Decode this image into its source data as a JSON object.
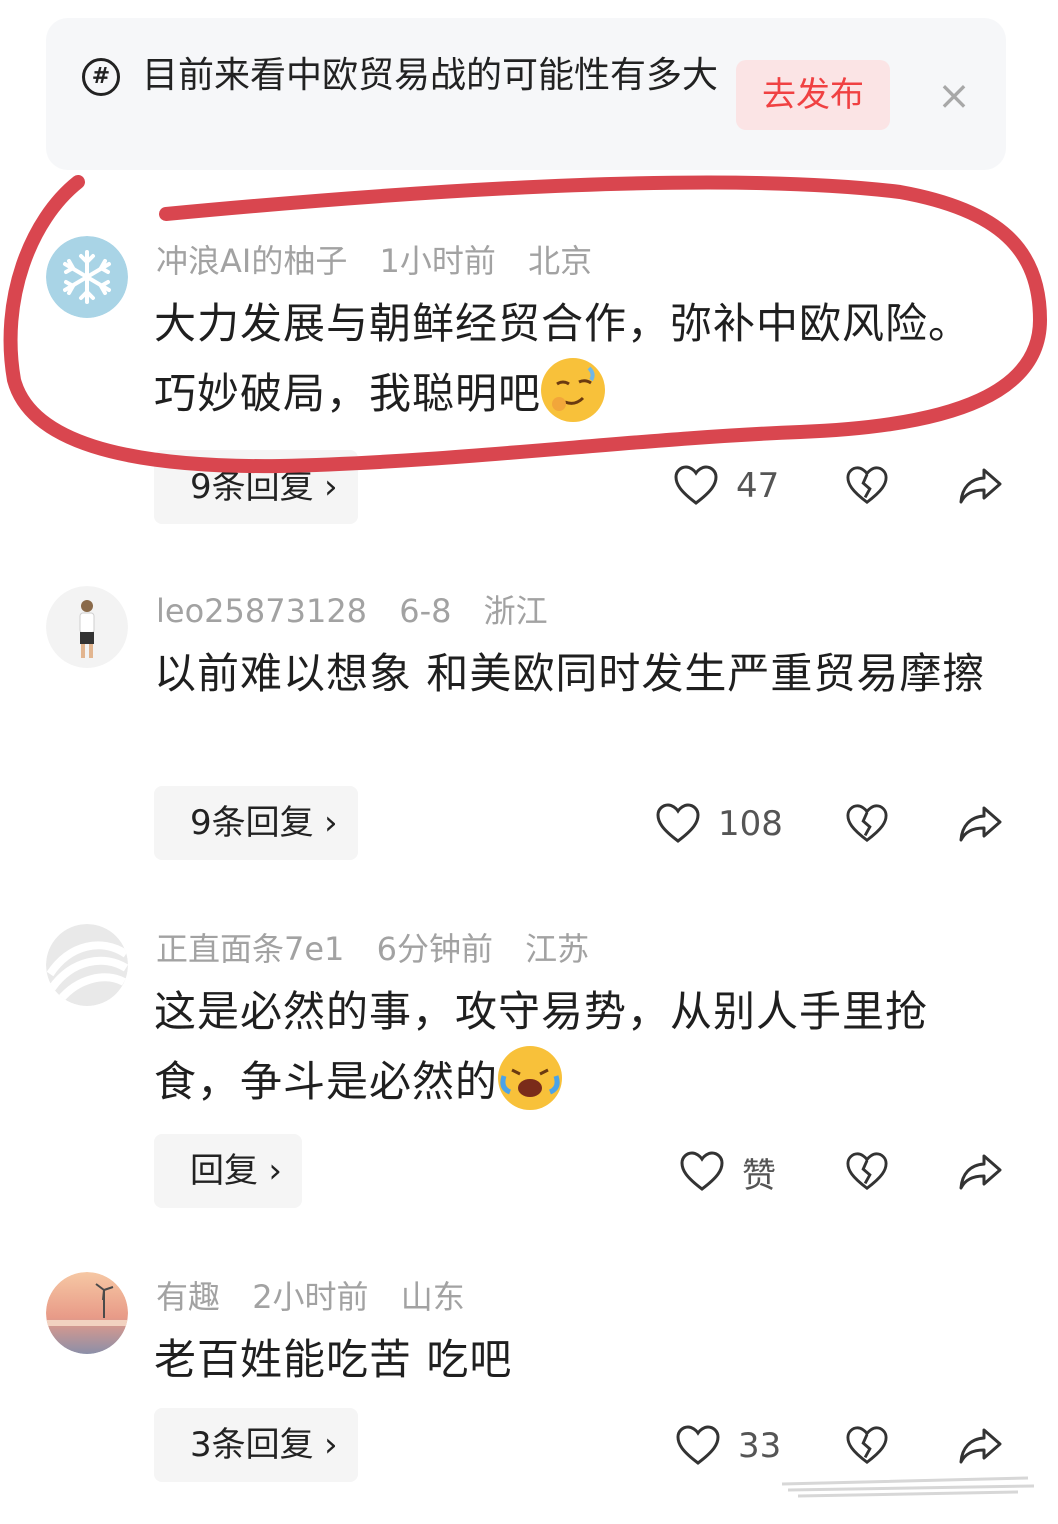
{
  "topic": {
    "icon": "hashtag-icon",
    "text": "目前来看中欧贸易战的可能性有多大",
    "publish_label": "去发布",
    "close_icon": "close-icon"
  },
  "comments": [
    {
      "user": "冲浪AI的柚子",
      "time": "1小时前",
      "location": "北京",
      "text": "大力发展与朝鲜经贸合作，弥补中欧风险。巧妙破局，我聪明吧",
      "emoji": "smirk-emoji",
      "reply_label": "9条回复",
      "likes": "47",
      "highlighted": true
    },
    {
      "user": "leo25873128",
      "time": "6-8",
      "location": "浙江",
      "text": "以前难以想象 和美欧同时发生严重贸易摩擦",
      "reply_label": "9条回复",
      "likes": "108"
    },
    {
      "user": "正直面条7e1",
      "time": "6分钟前",
      "location": "江苏",
      "text": "这是必然的事，攻守易势，从别人手里抢食，争斗是必然的",
      "emoji": "laughing-crying-emoji",
      "reply_label": "回复",
      "likes": "赞"
    },
    {
      "user": "有趣",
      "time": "2小时前",
      "location": "山东",
      "text": "老百姓能吃苦 吃吧",
      "reply_label": "3条回复",
      "likes": "33"
    }
  ],
  "chevron": "›",
  "colors": {
    "accent": "#f04142",
    "publish_bg": "#fbe4e5",
    "annotation": "#d9464f",
    "meta_text": "#a2a2a2"
  }
}
